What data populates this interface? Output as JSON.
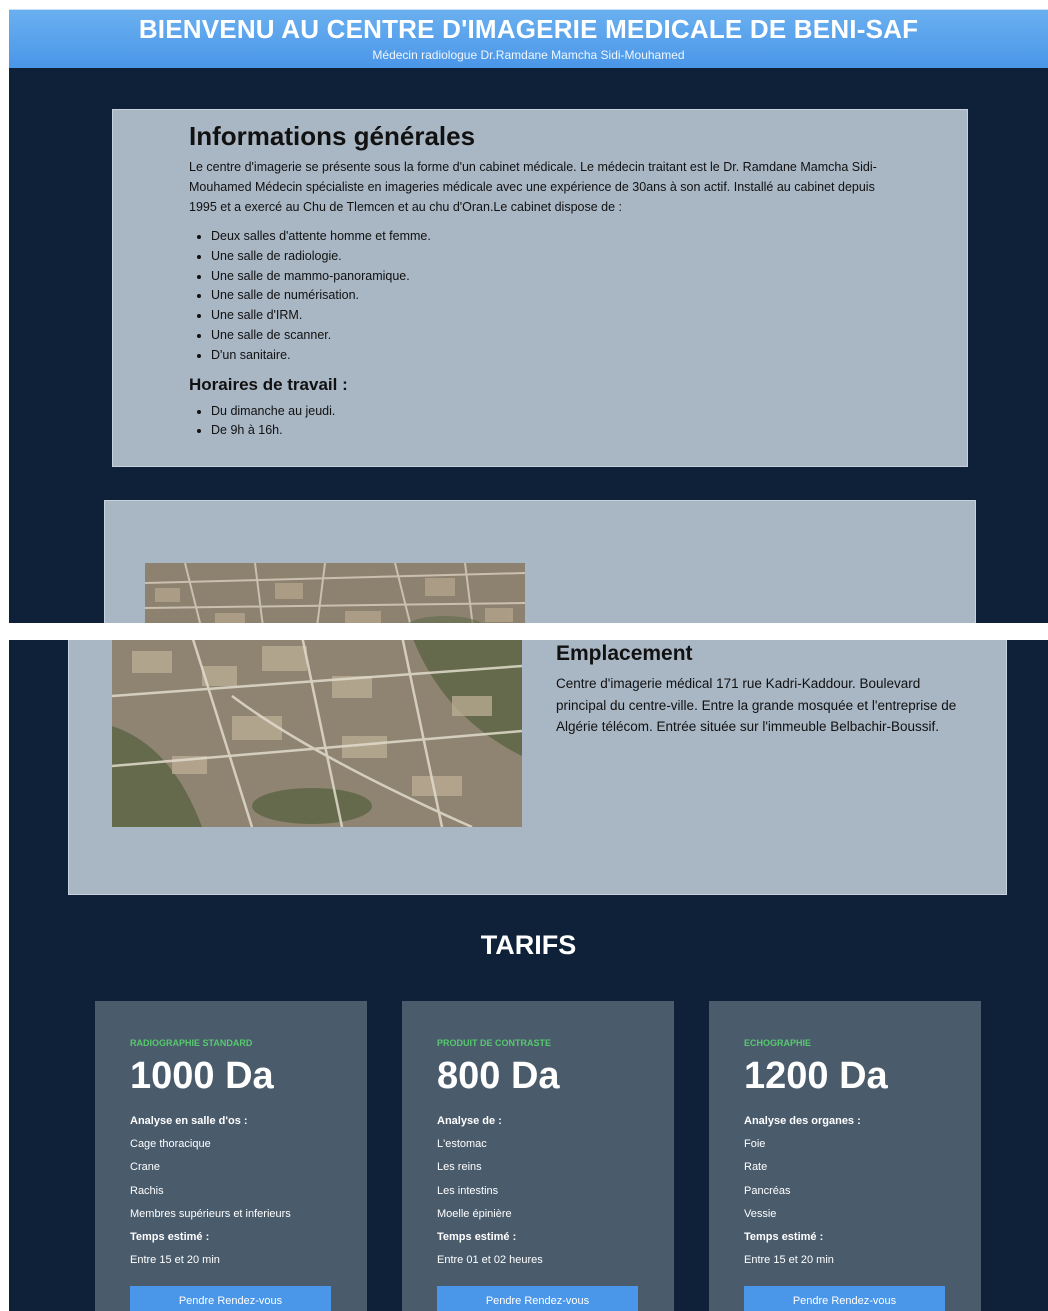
{
  "header": {
    "title": "BIENVENU AU CENTRE D'IMAGERIE MEDICALE DE BENI-SAF",
    "subtitle": "Médecin radiologue Dr.Ramdane Mamcha Sidi-Mouhamed"
  },
  "info": {
    "title": "Informations générales",
    "text": "Le centre d'imagerie se présente sous la forme d'un cabinet médicale. Le médecin traitant est le Dr. Ramdane Mamcha Sidi-Mouhamed Médecin spécialiste en imageries médicale avec une expérience de 30ans à son actif. Installé au cabinet depuis 1995 et a exercé au Chu de Tlemcen et au chu d'Oran.Le cabinet dispose de :",
    "rooms": [
      "Deux salles d'attente homme et femme.",
      "Une salle de radiologie.",
      "Une salle de mammo-panoramique.",
      "Une salle de numérisation.",
      "Une salle d'IRM.",
      "Une salle de scanner.",
      "D'un sanitaire."
    ],
    "hours_title": "Horaires de travail :",
    "hours": [
      "Du dimanche au jeudi.",
      "De 9h à 16h."
    ]
  },
  "location": {
    "title": "Emplacement",
    "text": "Centre d'imagerie médical 171 rue Kadri-Kaddour. Boulevard principal du centre-ville. Entre la grande mosquée et l'entreprise de Algérie télécom. Entrée située sur l'immeuble Belbachir-Boussif."
  },
  "tarifs": {
    "title": "TARIFS",
    "cards": [
      {
        "category": "RADIOGRAPHIE STANDARD",
        "price": "1000 Da",
        "lines": [
          {
            "text": "Analyse en salle d'os :",
            "bold": true
          },
          {
            "text": "Cage thoracique",
            "bold": false
          },
          {
            "text": "Crane",
            "bold": false
          },
          {
            "text": "Rachis",
            "bold": false
          },
          {
            "text": "Membres supérieurs et inferieurs",
            "bold": false
          },
          {
            "text": "Temps estimé :",
            "bold": true
          },
          {
            "text": "Entre 15 et 20 min",
            "bold": false
          }
        ],
        "button": "Pendre Rendez-vous"
      },
      {
        "category": "PRODUIT DE CONTRASTE",
        "price": "800 Da",
        "lines": [
          {
            "text": "Analyse de :",
            "bold": true
          },
          {
            "text": "L'estomac",
            "bold": false
          },
          {
            "text": "Les reins",
            "bold": false
          },
          {
            "text": "Les intestins",
            "bold": false
          },
          {
            "text": "Moelle épinière",
            "bold": false
          },
          {
            "text": "Temps estimé :",
            "bold": true
          },
          {
            "text": "Entre 01 et 02 heures",
            "bold": false
          }
        ],
        "button": "Pendre Rendez-vous"
      },
      {
        "category": "ECHOGRAPHIE",
        "price": "1200 Da",
        "lines": [
          {
            "text": "Analyse des organes :",
            "bold": true
          },
          {
            "text": "Foie",
            "bold": false
          },
          {
            "text": "Rate",
            "bold": false
          },
          {
            "text": "Pancréas",
            "bold": false
          },
          {
            "text": "Vessie",
            "bold": false
          },
          {
            "text": "Temps estimé :",
            "bold": true
          },
          {
            "text": "Entre 15 et 20 min",
            "bold": false
          }
        ],
        "button": "Pendre Rendez-vous"
      }
    ]
  },
  "colors": {
    "page_background": "#0f2139",
    "header_blue": "#4a96e8",
    "card_grey": "#a9b6c4",
    "price_card": "#4a5b6c",
    "category_green": "#57c86e"
  }
}
